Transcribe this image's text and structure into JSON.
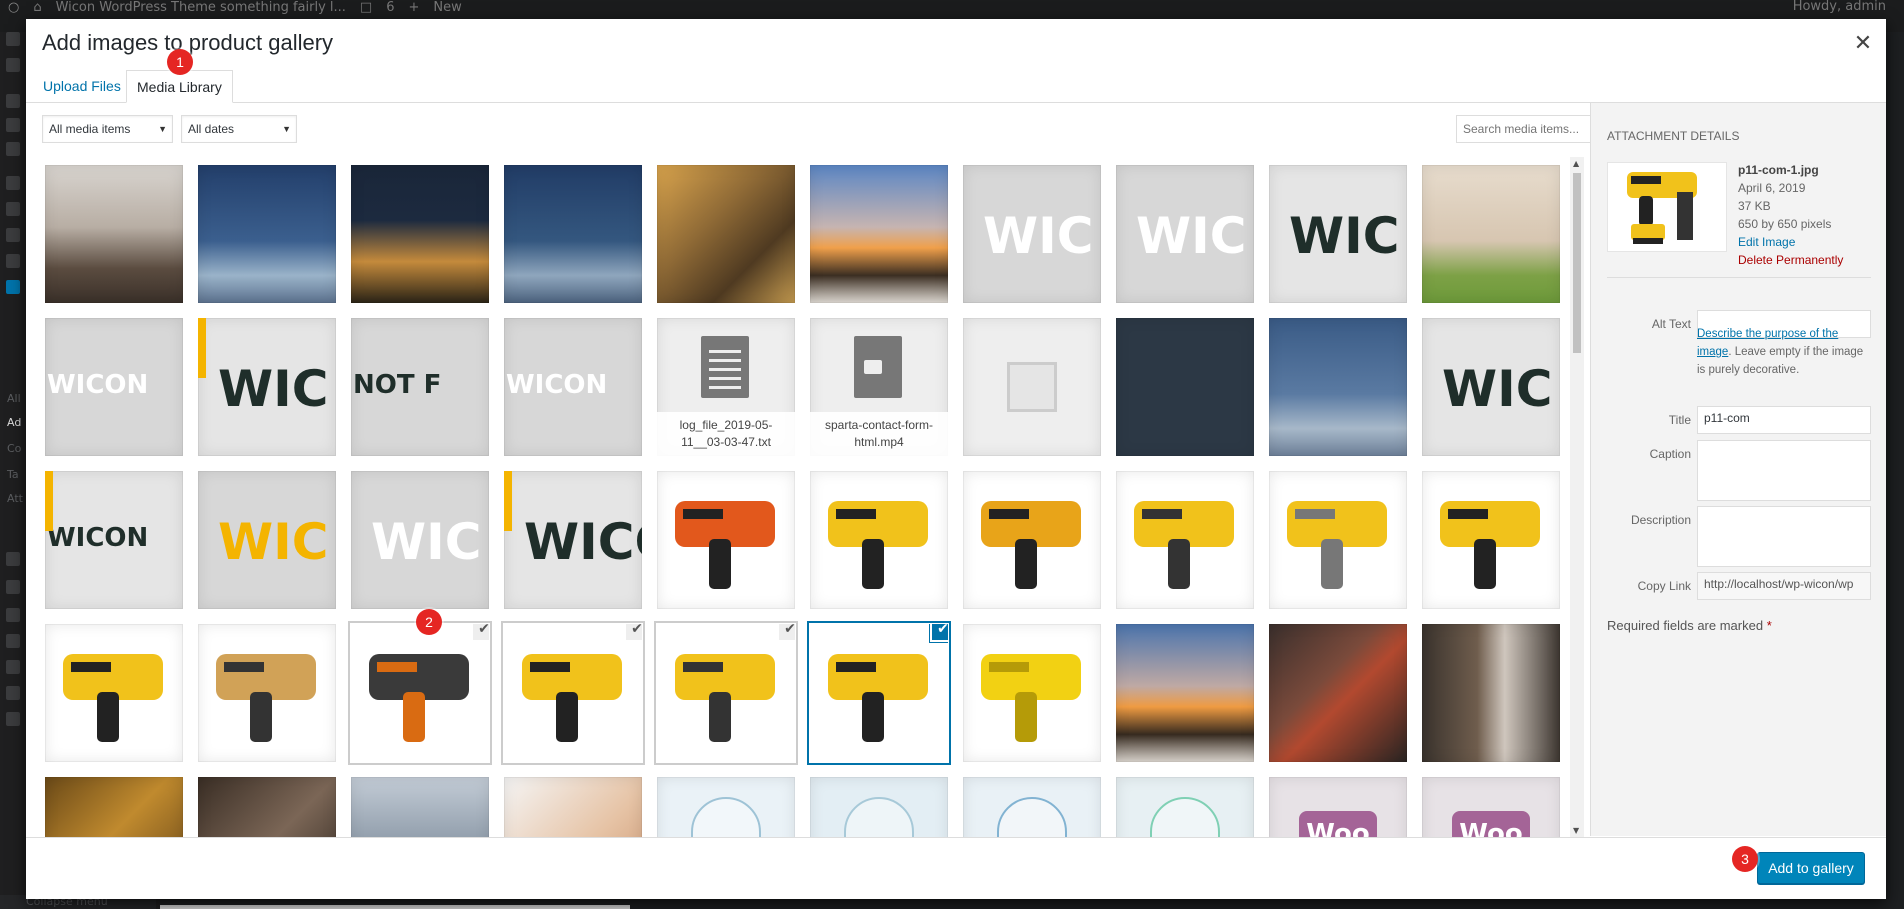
{
  "admin_bar": {
    "site_title": "Wicon WordPress Theme something fairly l...",
    "comments_count": "6",
    "new_label": "New",
    "howdy": "Howdy, admin"
  },
  "admin_menu": {
    "labels": [
      "All",
      "Ad",
      "Co",
      "Ta",
      "Att"
    ],
    "collapse_label": "Collapse menu"
  },
  "modal": {
    "title": "Add images to product gallery",
    "close_icon": "close-icon",
    "tabs": [
      {
        "label": "Upload Files",
        "active": false
      },
      {
        "label": "Media Library",
        "active": true
      }
    ]
  },
  "toolbar": {
    "filter_type": "All media items",
    "filter_date": "All dates",
    "search_placeholder": "Search media items..."
  },
  "attachments": [
    {
      "kind": "photo",
      "desc": "meeting room",
      "bg": "linear-gradient(180deg,#d8d4cf 0%,#b8aea4 45%,#5b4c40 75%,#3a3029 100%)"
    },
    {
      "kind": "photo",
      "desc": "bridge night",
      "bg": "linear-gradient(180deg,#233f6b 0%,#3b5f8e 55%,#9ab3c9 80%,#5d7390 100%)"
    },
    {
      "kind": "photo",
      "desc": "city night",
      "bg": "linear-gradient(180deg,#1a2639 0%,#1c2a3f 40%,#c48a3c 70%,#2b2417 100%)"
    },
    {
      "kind": "photo",
      "desc": "bridge night",
      "bg": "linear-gradient(180deg,#213c66 0%,#34577f 55%,#8fa6bd 80%,#4d6480 100%)"
    },
    {
      "kind": "photo",
      "desc": "tools on wood",
      "bg": "linear-gradient(135deg,#d9a44d 0%,#8f6a36 40%,#4f3a21 70%,#c49a4f 100%)"
    },
    {
      "kind": "photo",
      "desc": "bulldozer sunset",
      "bg": "linear-gradient(180deg,#5b86c4 0%,#c6b4b1 45%,#f0a04b 60%,#3b2e22 80%,#e2ddd6 100%)"
    },
    {
      "kind": "placeholder",
      "text": "WIC",
      "color": "#ffffff",
      "bg": "#d7d7d7"
    },
    {
      "kind": "placeholder",
      "text": "WIC",
      "color": "#ffffff",
      "bg": "#d7d7d7"
    },
    {
      "kind": "placeholder",
      "text": "WIC",
      "color": "#1f2e2a",
      "bg": "#e5e5e5"
    },
    {
      "kind": "photo",
      "desc": "wall grass",
      "bg": "linear-gradient(180deg,#e7dccd 0%,#d7c6b1 55%,#7da146 80%,#6d9a3a 100%)"
    },
    {
      "kind": "placeholder",
      "text": "WICON",
      "color": "#ffffff",
      "bg": "#d7d7d7"
    },
    {
      "kind": "placeholder",
      "text": "WIC",
      "color": "#1f2e2a",
      "bg": "#e5e5e5",
      "accent": "#f4b400"
    },
    {
      "kind": "placeholder",
      "text": "NOT F",
      "color": "#1f2e2a",
      "bg": "#d7d7d7"
    },
    {
      "kind": "placeholder",
      "text": "WICON",
      "color": "#ffffff",
      "bg": "#d7d7d7"
    },
    {
      "kind": "file",
      "icon": "document-icon",
      "filename": "log_file_2019-05-11__03-03-47.txt"
    },
    {
      "kind": "file",
      "icon": "video-icon",
      "filename": "sparta-contact-form-html.mp4"
    },
    {
      "kind": "placeholder-image",
      "icon": "image-icon",
      "bg": "#eeeeee"
    },
    {
      "kind": "photo",
      "desc": "dark slate",
      "bg": "#2c3845"
    },
    {
      "kind": "photo",
      "desc": "bridge dusk",
      "bg": "linear-gradient(180deg,#3a5b86 0%,#5a7aa2 55%,#a7b8c9 80%,#6e819a 100%)"
    },
    {
      "kind": "placeholder",
      "text": "WIC",
      "color": "#1f2e2a",
      "bg": "#e5e5e5"
    },
    {
      "kind": "placeholder",
      "text": "WICON",
      "color": "#1f2e2a",
      "bg": "#e5e5e5",
      "accent": "#f4b400"
    },
    {
      "kind": "placeholder",
      "text": "WIC",
      "color": "#f4b400",
      "bg": "#d7d7d7"
    },
    {
      "kind": "placeholder",
      "text": "WIC",
      "color": "#ffffff",
      "bg": "#d7d7d7"
    },
    {
      "kind": "placeholder",
      "text": "WICC",
      "color": "#1f2e2a",
      "bg": "#e5e5e5",
      "accent": "#f4b400"
    },
    {
      "kind": "product",
      "desc": "orange generator",
      "bg": "#ffffff",
      "main": "#e2581c",
      "dark": "#222"
    },
    {
      "kind": "product",
      "desc": "multi tool",
      "bg": "#ffffff",
      "main": "#f1c21b",
      "dark": "#222"
    },
    {
      "kind": "product",
      "desc": "pickaxe",
      "bg": "#ffffff",
      "main": "#e8a419",
      "dark": "#222"
    },
    {
      "kind": "product",
      "desc": "circular saw",
      "bg": "#ffffff",
      "main": "#f1c21b",
      "dark": "#333"
    },
    {
      "kind": "product",
      "desc": "circular saw",
      "bg": "#ffffff",
      "main": "#f1c21b",
      "dark": "#777"
    },
    {
      "kind": "product",
      "desc": "oscillating tool",
      "bg": "#ffffff",
      "main": "#f1c21b",
      "dark": "#222"
    },
    {
      "kind": "product",
      "desc": "yellow generator",
      "bg": "#ffffff",
      "main": "#f1c21b",
      "dark": "#222"
    },
    {
      "kind": "product",
      "desc": "miter box saw",
      "bg": "#ffffff",
      "main": "#d1a257",
      "dark": "#333"
    },
    {
      "kind": "product",
      "desc": "rotary hammer",
      "bg": "#ffffff",
      "main": "#3a3a3a",
      "dark": "#d96b12",
      "selected": true
    },
    {
      "kind": "product",
      "desc": "cordless drill",
      "bg": "#ffffff",
      "main": "#f1c21b",
      "dark": "#222",
      "selected": true
    },
    {
      "kind": "product",
      "desc": "rotary hammer",
      "bg": "#ffffff",
      "main": "#f1c21b",
      "dark": "#333",
      "selected": true
    },
    {
      "kind": "product",
      "desc": "nail gun",
      "bg": "#ffffff",
      "main": "#f1c21b",
      "dark": "#222",
      "selected": true,
      "current": true
    },
    {
      "kind": "product",
      "desc": "container generator",
      "bg": "#ffffff",
      "main": "#f2d113",
      "dark": "#b59b08"
    },
    {
      "kind": "photo",
      "desc": "bulldozer sunset",
      "bg": "linear-gradient(180deg,#4b74ad 0%,#bfa9a4 45%,#ef9b42 60%,#362a1f 80%,#ded8d1 100%)"
    },
    {
      "kind": "photo",
      "desc": "welder",
      "bg": "linear-gradient(135deg,#3a2f2c 0%,#7a4a3b 40%,#b2492f 55%,#2a2523 100%)"
    },
    {
      "kind": "photo",
      "desc": "worker tools",
      "bg": "linear-gradient(90deg,#3a332d 0%,#6f5d4d 40%,#cfc6bd 60%,#3e3731 100%)"
    },
    {
      "kind": "photo",
      "desc": "gold texture",
      "bg": "linear-gradient(135deg,#6b4a18 0%,#c08a2e 45%,#5a3c15 100%)"
    },
    {
      "kind": "photo",
      "desc": "hammers",
      "bg": "linear-gradient(135deg,#3a2e25 0%,#7b6656 50%,#2a221c 100%)"
    },
    {
      "kind": "photo",
      "desc": "building",
      "bg": "linear-gradient(180deg,#c3ccd6 0%,#8d9aa8 50%,#6c7987 100%)"
    },
    {
      "kind": "photo",
      "desc": "smiling man",
      "bg": "linear-gradient(135deg,#f5f5f5 0%,#e6c3a5 55%,#c8906a 100%)"
    },
    {
      "kind": "illustration",
      "desc": "hoodie and hat",
      "bg": "#eaf2f7",
      "main": "#9ec3d6"
    },
    {
      "kind": "illustration",
      "desc": "light blue",
      "bg": "#e3eef4",
      "main": "#a7c9d8"
    },
    {
      "kind": "illustration",
      "desc": "cap",
      "bg": "#e9f1f6",
      "main": "#82b3d2"
    },
    {
      "kind": "illustration",
      "desc": "t-shirt",
      "bg": "#e7f0f3",
      "main": "#7fd0b4"
    },
    {
      "kind": "woo",
      "text": "Woo",
      "bg": "#e7e2e6",
      "main": "#a46497"
    },
    {
      "kind": "woo",
      "text": "Woo",
      "bg": "#e7e2e6",
      "main": "#a46497"
    }
  ],
  "badges": [
    "1",
    "2",
    "3"
  ],
  "details": {
    "heading": "Attachment Details",
    "filename": "p11-com-1.jpg",
    "date": "April 6, 2019",
    "size": "37 KB",
    "dimensions": "650 by 650 pixels",
    "edit_label": "Edit Image",
    "delete_label": "Delete Permanently",
    "alt_label": "Alt Text",
    "alt_value": "",
    "alt_help_link": "Describe the purpose of the image",
    "alt_help_rest": ". Leave empty if the image is purely decorative.",
    "title_label": "Title",
    "title_value": "p11-com",
    "caption_label": "Caption",
    "caption_value": "",
    "description_label": "Description",
    "description_value": "",
    "copy_link_label": "Copy Link",
    "copy_link_value": "http://localhost/wp-wicon/wp",
    "required_text": "Required fields are marked",
    "required_star": "*"
  },
  "footer": {
    "add_button": "Add to gallery"
  }
}
